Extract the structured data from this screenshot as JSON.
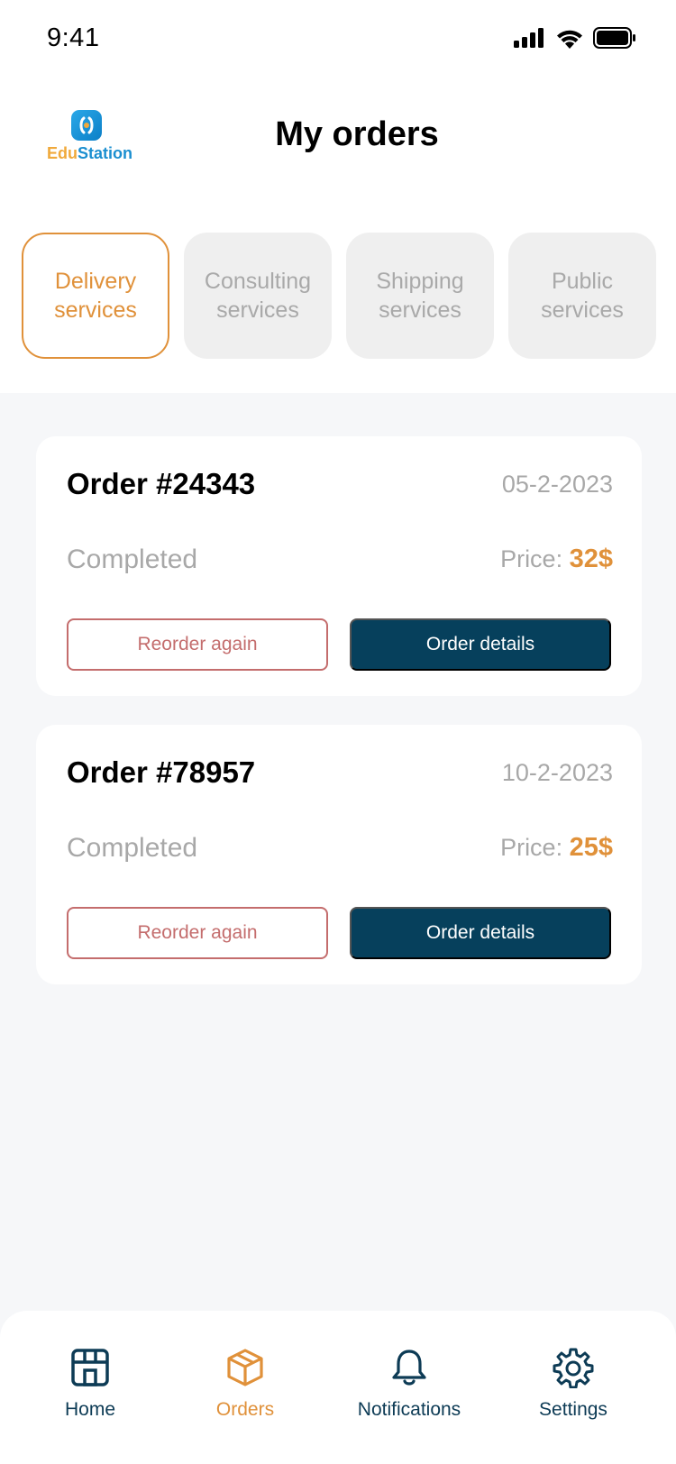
{
  "status_bar": {
    "time": "9:41",
    "icons": [
      "cellular-signal-icon",
      "wifi-icon",
      "battery-icon"
    ]
  },
  "header": {
    "logo_text_part1": "Edu",
    "logo_text_part2": "Station",
    "title": "My orders"
  },
  "tabs": [
    {
      "line1": "Delivery",
      "line2": "services",
      "active": true
    },
    {
      "line1": "Consulting",
      "line2": "services",
      "active": false
    },
    {
      "line1": "Shipping",
      "line2": "services",
      "active": false
    },
    {
      "line1": "Public",
      "line2": "services",
      "active": false
    }
  ],
  "orders": [
    {
      "title": "Order #24343",
      "date": "05-2-2023",
      "status": "Completed",
      "price_label": "Price:",
      "price_value": "32$",
      "reorder_label": "Reorder again",
      "details_label": "Order details"
    },
    {
      "title": "Order #78957",
      "date": "10-2-2023",
      "status": "Completed",
      "price_label": "Price:",
      "price_value": "25$",
      "reorder_label": "Reorder again",
      "details_label": "Order details"
    }
  ],
  "bottom_nav": [
    {
      "label": "Home",
      "icon": "store-icon",
      "active": false
    },
    {
      "label": "Orders",
      "icon": "package-icon",
      "active": true
    },
    {
      "label": "Notifications",
      "icon": "bell-icon",
      "active": false
    },
    {
      "label": "Settings",
      "icon": "gear-icon",
      "active": false
    }
  ],
  "colors": {
    "accent": "#e0913a",
    "primary_dark": "#06405c",
    "nav_text": "#0d3b55",
    "reorder_border": "#c46d6d",
    "muted_text": "#a8a8a8",
    "background": "#f6f7f9"
  }
}
